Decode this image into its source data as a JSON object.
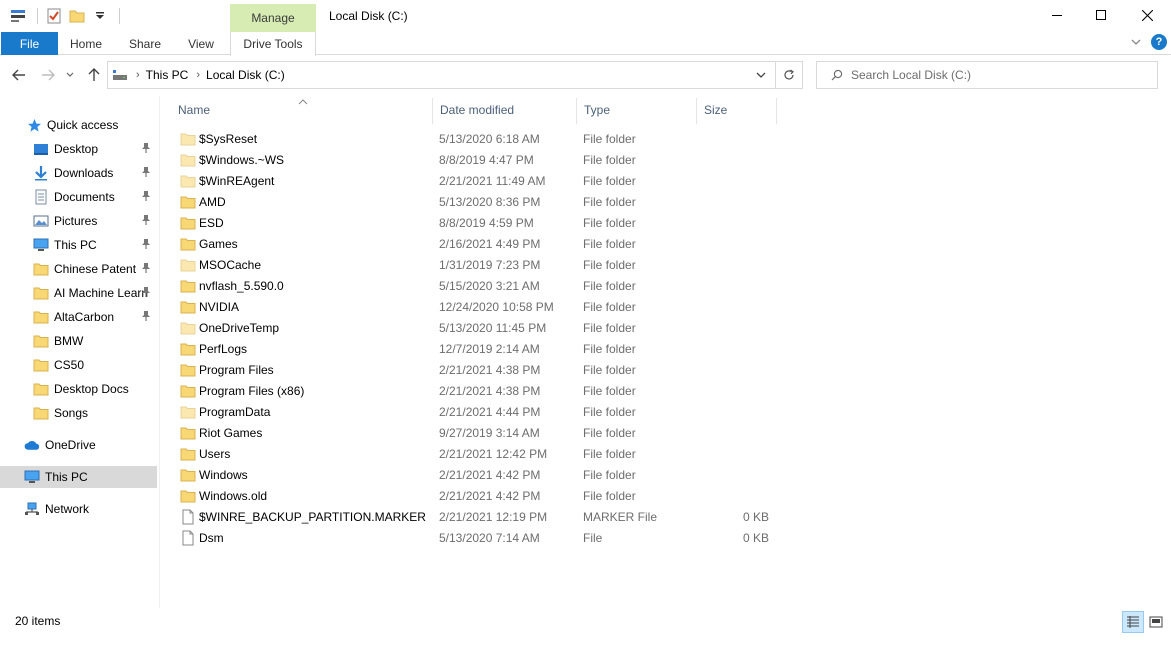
{
  "window": {
    "title": "Local Disk (C:)",
    "manage_tab": "Manage"
  },
  "ribbon": {
    "tabs": [
      "File",
      "Home",
      "Share",
      "View",
      "Drive Tools"
    ]
  },
  "address": {
    "segments": [
      "This PC",
      "Local Disk (C:)"
    ]
  },
  "search": {
    "placeholder": "Search Local Disk (C:)"
  },
  "nav": {
    "quick_access": "Quick access",
    "pinned": [
      "Desktop",
      "Downloads",
      "Documents",
      "Pictures",
      "This PC",
      "Chinese Patent",
      "AI Machine Learn",
      "AltaCarbon"
    ],
    "folders": [
      "BMW",
      "CS50",
      "Desktop Docs",
      "Songs"
    ],
    "onedrive": "OneDrive",
    "this_pc": "This PC",
    "network": "Network"
  },
  "columns": {
    "name": "Name",
    "date": "Date modified",
    "type": "Type",
    "size": "Size"
  },
  "files": [
    {
      "name": "$SysReset",
      "date": "5/13/2020 6:18 AM",
      "type": "File folder",
      "size": "",
      "icon": "folder-light-icon"
    },
    {
      "name": "$Windows.~WS",
      "date": "8/8/2019 4:47 PM",
      "type": "File folder",
      "size": "",
      "icon": "folder-light-icon"
    },
    {
      "name": "$WinREAgent",
      "date": "2/21/2021 11:49 AM",
      "type": "File folder",
      "size": "",
      "icon": "folder-light-icon"
    },
    {
      "name": "AMD",
      "date": "5/13/2020 8:36 PM",
      "type": "File folder",
      "size": "",
      "icon": "folder-icon"
    },
    {
      "name": "ESD",
      "date": "8/8/2019 4:59 PM",
      "type": "File folder",
      "size": "",
      "icon": "folder-icon"
    },
    {
      "name": "Games",
      "date": "2/16/2021 4:49 PM",
      "type": "File folder",
      "size": "",
      "icon": "folder-icon"
    },
    {
      "name": "MSOCache",
      "date": "1/31/2019 7:23 PM",
      "type": "File folder",
      "size": "",
      "icon": "folder-light-icon"
    },
    {
      "name": "nvflash_5.590.0",
      "date": "5/15/2020 3:21 AM",
      "type": "File folder",
      "size": "",
      "icon": "folder-icon"
    },
    {
      "name": "NVIDIA",
      "date": "12/24/2020 10:58 PM",
      "type": "File folder",
      "size": "",
      "icon": "folder-icon"
    },
    {
      "name": "OneDriveTemp",
      "date": "5/13/2020 11:45 PM",
      "type": "File folder",
      "size": "",
      "icon": "folder-light-icon"
    },
    {
      "name": "PerfLogs",
      "date": "12/7/2019 2:14 AM",
      "type": "File folder",
      "size": "",
      "icon": "folder-icon"
    },
    {
      "name": "Program Files",
      "date": "2/21/2021 4:38 PM",
      "type": "File folder",
      "size": "",
      "icon": "folder-icon"
    },
    {
      "name": "Program Files (x86)",
      "date": "2/21/2021 4:38 PM",
      "type": "File folder",
      "size": "",
      "icon": "folder-icon"
    },
    {
      "name": "ProgramData",
      "date": "2/21/2021 4:44 PM",
      "type": "File folder",
      "size": "",
      "icon": "folder-light-icon"
    },
    {
      "name": "Riot Games",
      "date": "9/27/2019 3:14 AM",
      "type": "File folder",
      "size": "",
      "icon": "folder-icon"
    },
    {
      "name": "Users",
      "date": "2/21/2021 12:42 PM",
      "type": "File folder",
      "size": "",
      "icon": "folder-icon"
    },
    {
      "name": "Windows",
      "date": "2/21/2021 4:42 PM",
      "type": "File folder",
      "size": "",
      "icon": "folder-icon"
    },
    {
      "name": "Windows.old",
      "date": "2/21/2021 4:42 PM",
      "type": "File folder",
      "size": "",
      "icon": "folder-icon"
    },
    {
      "name": "$WINRE_BACKUP_PARTITION.MARKER",
      "date": "2/21/2021 12:19 PM",
      "type": "MARKER File",
      "size": "0 KB",
      "icon": "file-icon"
    },
    {
      "name": "Dsm",
      "date": "5/13/2020 7:14 AM",
      "type": "File",
      "size": "0 KB",
      "icon": "file-icon"
    }
  ],
  "status": {
    "item_count": "20 items"
  },
  "colors": {
    "accent": "#1979ca",
    "manage_bg": "#d7ecb3",
    "folder": "#f8d775",
    "folder_light": "#fbe8b0",
    "header_text": "#4c607a",
    "selected_nav": "#d9d9d9"
  }
}
